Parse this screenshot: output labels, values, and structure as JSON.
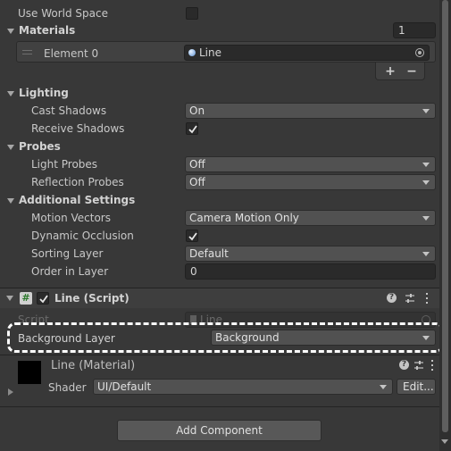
{
  "top": {
    "use_world_space_label": "Use World Space"
  },
  "materials": {
    "section_label": "Materials",
    "size_value": "1",
    "element_label": "Element 0",
    "element_value": "Line",
    "add_label": "+",
    "remove_label": "−"
  },
  "lighting": {
    "section_label": "Lighting",
    "cast_shadows_label": "Cast Shadows",
    "cast_shadows_value": "On",
    "receive_shadows_label": "Receive Shadows"
  },
  "probes": {
    "section_label": "Probes",
    "light_probes_label": "Light Probes",
    "light_probes_value": "Off",
    "reflection_probes_label": "Reflection Probes",
    "reflection_probes_value": "Off"
  },
  "additional": {
    "section_label": "Additional Settings",
    "motion_vectors_label": "Motion Vectors",
    "motion_vectors_value": "Camera Motion Only",
    "dynamic_occlusion_label": "Dynamic Occlusion",
    "sorting_layer_label": "Sorting Layer",
    "sorting_layer_value": "Default",
    "order_in_layer_label": "Order in Layer",
    "order_in_layer_value": "0"
  },
  "line_script": {
    "title": "Line (Script)",
    "script_label": "Script",
    "script_value": "Line",
    "background_layer_label": "Background Layer",
    "background_layer_value": "Background"
  },
  "material_panel": {
    "title": "Line (Material)",
    "shader_label": "Shader",
    "shader_value": "UI/Default",
    "edit_label": "Edit..."
  },
  "footer": {
    "add_component_label": "Add Component"
  },
  "colors": {
    "background": "#383838",
    "field": "#2a2a2a",
    "dropdown": "#515151",
    "highlight_dash": "#ffffff"
  }
}
